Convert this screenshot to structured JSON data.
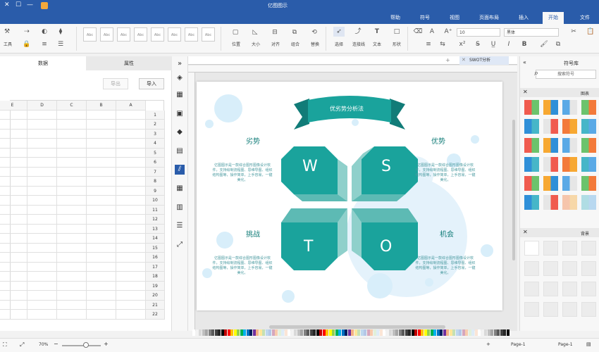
{
  "titlebar": {
    "title": "亿图图示",
    "minimize": "—",
    "maximize": "☐",
    "close": "✕"
  },
  "tabs": [
    "文件",
    "开始",
    "插入",
    "页面布局",
    "视图",
    "符号",
    "帮助"
  ],
  "ribbon": {
    "tool_label": "工具",
    "select_label": "选择",
    "connector_label": "连接线",
    "text_label": "文本",
    "shape_label": "形状",
    "font_name": "黑体",
    "font_size": "10",
    "style_sample": "Abc",
    "group_labels": [
      "位置",
      "大小",
      "对齐",
      "组合",
      "替换",
      "锁定"
    ]
  },
  "leftpanel": {
    "tab_props": "属性",
    "tab_data": "数据",
    "import_button": "导入",
    "export_button": "导出",
    "columns": [
      "A",
      "B",
      "C",
      "D",
      "E"
    ],
    "rows": [
      "1",
      "2",
      "3",
      "4",
      "5",
      "6",
      "7",
      "8",
      "9",
      "10",
      "11",
      "12",
      "13",
      "14",
      "15",
      "16",
      "17",
      "18",
      "19",
      "20",
      "21",
      "22"
    ]
  },
  "doctab": {
    "name": "SWOT分析"
  },
  "library": {
    "title": "符号库",
    "search_placeholder": "搜索符号",
    "section1": "图表",
    "section2": "背景"
  },
  "diagram": {
    "banner": "优劣势分析法",
    "s_title": "优势",
    "w_title": "劣势",
    "o_title": "机会",
    "t_title": "挑战",
    "s_letter": "S",
    "w_letter": "W",
    "o_letter": "O",
    "t_letter": "T",
    "body": "亿图图示是一款综合图形图像设计软件，支持绘制流程图、思维导图、组织结构图等，操作简单，上手容易，一键美化。"
  },
  "statusbar": {
    "page_label": "Page-1",
    "page_tab": "Page-1",
    "zoom": "70%",
    "add": "+"
  },
  "colors": {
    "brand": "#2a5caa",
    "teal": "#1aa39c",
    "teal_dark": "#117c78",
    "bubble": "#d8eefa"
  }
}
